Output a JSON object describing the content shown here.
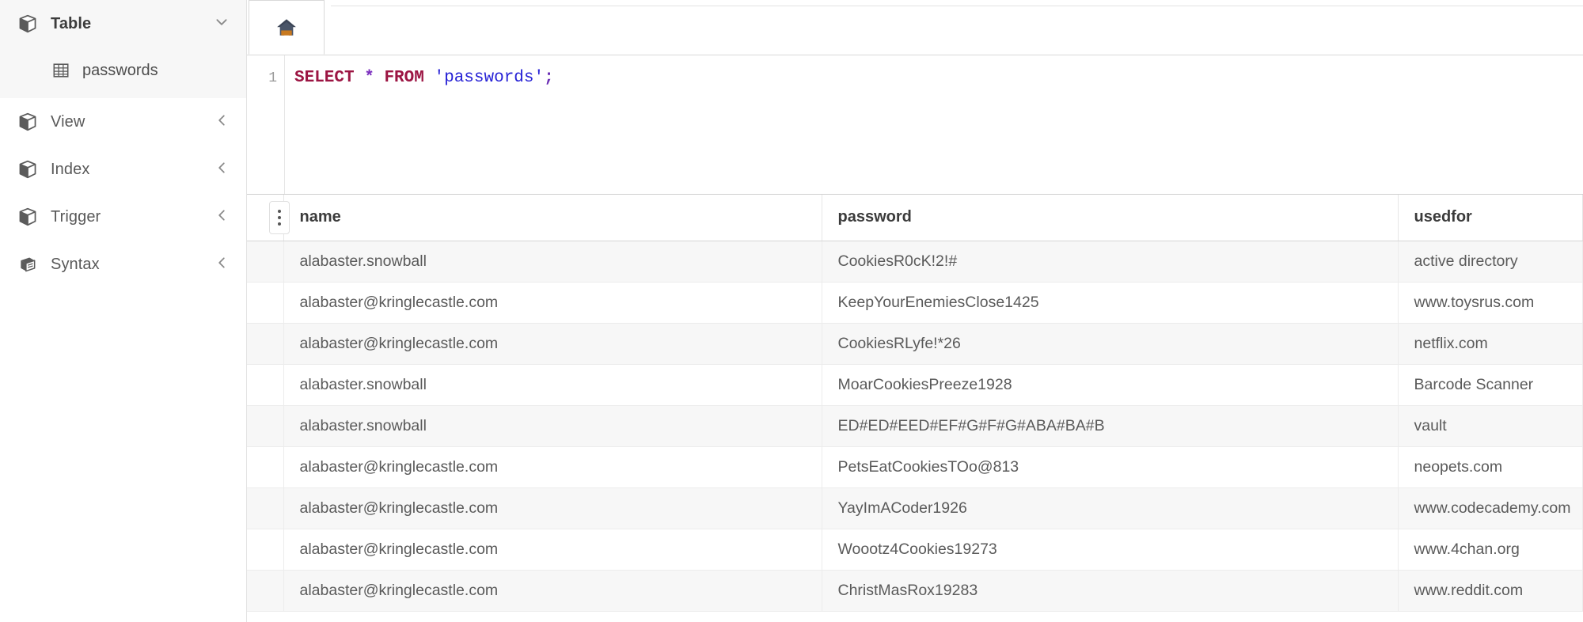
{
  "sidebar": {
    "groups": [
      {
        "label": "Table",
        "icon": "cube-icon",
        "chevron": "chevron-down-icon",
        "expanded": true,
        "children": [
          {
            "label": "passwords",
            "icon": "grid-table-icon"
          }
        ]
      },
      {
        "label": "View",
        "icon": "cube-icon",
        "chevron": "chevron-left-icon",
        "expanded": false,
        "children": []
      },
      {
        "label": "Index",
        "icon": "cube-icon",
        "chevron": "chevron-left-icon",
        "expanded": false,
        "children": []
      },
      {
        "label": "Trigger",
        "icon": "cube-icon",
        "chevron": "chevron-left-icon",
        "expanded": false,
        "children": []
      },
      {
        "label": "Syntax",
        "icon": "book-icon",
        "chevron": "chevron-left-icon",
        "expanded": false,
        "children": []
      }
    ]
  },
  "tabs": [
    {
      "icon": "home-icon",
      "label": "",
      "active": true
    }
  ],
  "editor": {
    "line_number": "1",
    "tokens": [
      {
        "text": "SELECT",
        "type": "keyword"
      },
      {
        "text": " ",
        "type": "plain"
      },
      {
        "text": "*",
        "type": "operator"
      },
      {
        "text": " ",
        "type": "plain"
      },
      {
        "text": "FROM",
        "type": "keyword"
      },
      {
        "text": " ",
        "type": "plain"
      },
      {
        "text": "'passwords'",
        "type": "string"
      },
      {
        "text": ";",
        "type": "punctuation"
      }
    ],
    "query_text": "SELECT * FROM 'passwords';"
  },
  "results": {
    "row_handle_icon": "vertical-dots-icon",
    "columns": [
      "name",
      "password",
      "usedfor"
    ],
    "rows": [
      [
        "alabaster.snowball",
        "CookiesR0cK!2!#",
        "active directory"
      ],
      [
        "alabaster@kringlecastle.com",
        "KeepYourEnemiesClose1425",
        "www.toysrus.com"
      ],
      [
        "alabaster@kringlecastle.com",
        "CookiesRLyfe!*26",
        "netflix.com"
      ],
      [
        "alabaster.snowball",
        "MoarCookiesPreeze1928",
        "Barcode Scanner"
      ],
      [
        "alabaster.snowball",
        "ED#ED#EED#EF#G#F#G#ABA#BA#B",
        "vault"
      ],
      [
        "alabaster@kringlecastle.com",
        "PetsEatCookiesTOo@813",
        "neopets.com"
      ],
      [
        "alabaster@kringlecastle.com",
        "YayImACoder1926",
        "www.codecademy.com"
      ],
      [
        "alabaster@kringlecastle.com",
        "Woootz4Cookies19273",
        "www.4chan.org"
      ],
      [
        "alabaster@kringlecastle.com",
        "ChristMasRox19283",
        "www.reddit.com"
      ]
    ]
  },
  "colors": {
    "sql_keyword": "#9c1543",
    "sql_string": "#2722d6",
    "sql_operator": "#7b2fbe",
    "row_stripe": "#f7f7f7",
    "sidebar_active_bg": "#f7f7f7",
    "text_primary": "#5a5a5a"
  }
}
